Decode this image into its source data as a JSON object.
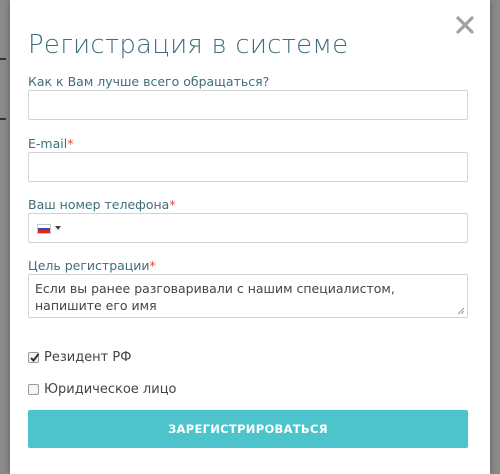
{
  "modal": {
    "title": "Регистрация в системе",
    "close_icon": "close-icon"
  },
  "form": {
    "name": {
      "label": "Как к Вам лучше всего обращаться?",
      "value": "",
      "placeholder": ""
    },
    "email": {
      "label": "E-mail",
      "required_mark": "*",
      "value": "",
      "placeholder": ""
    },
    "phone": {
      "label": "Ваш номер телефона",
      "required_mark": "*",
      "country_flag": "russia-flag-icon",
      "value": ""
    },
    "purpose": {
      "label": "Цель регистрации",
      "required_mark": "*",
      "placeholder": "Если вы ранее разговаривали с нашим специалистом, напишите его имя"
    },
    "resident": {
      "label": "Резидент РФ",
      "checked": true
    },
    "legal_entity": {
      "label": "Юридическое лицо",
      "checked": false
    },
    "submit_label": "ЗАРЕГИСТРИРОВАТЬСЯ"
  },
  "colors": {
    "title": "#3d6e7a",
    "required": "#e0493b",
    "button": "#4dc3cc"
  }
}
